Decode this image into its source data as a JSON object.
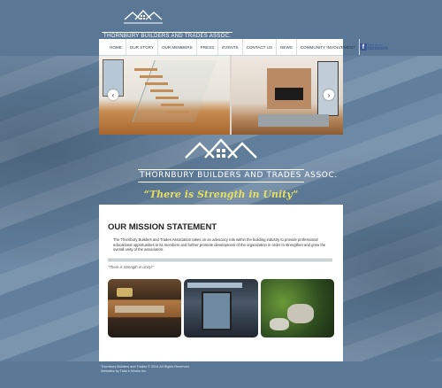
{
  "site": {
    "brand": "THORNBURY BUILDERS AND TRADES ASSOC.",
    "brand_small": "THORNBURY BUILDERS AND TRADES ASSOC.",
    "tagline": "“There is Strength in Unity”"
  },
  "nav": {
    "items": [
      {
        "label": "HOME"
      },
      {
        "label": "OUR STORY"
      },
      {
        "label": "OUR MEMBERS"
      },
      {
        "label": "PRESS"
      },
      {
        "label": "EVENTS"
      },
      {
        "label": "CONTACT US"
      },
      {
        "label": "NEWS"
      },
      {
        "label": "COMMUNITY INVOLVEMENT"
      }
    ],
    "facebook": {
      "small": "Find us on",
      "big": "facebook"
    }
  },
  "slider": {
    "prev_icon": "chevron-left-icon",
    "next_icon": "chevron-right-icon"
  },
  "mission": {
    "title": "OUR MISSION STATEMENT",
    "body": "The Thornbury Builders and Trades Association takes on an advocacy role within the building industry to provide professional educational opportunities to its members and further promote development of the organization in order to strengthen and grow the overall unity of the association.",
    "quote": "\"There is Strength in Unity!\""
  },
  "footer": {
    "copyright": "Thornbury Builders and Trades © 2014 All Rights Reserved.",
    "credit": "Websites by Tidal e-Works Inc."
  },
  "colors": {
    "background": "#5a7896",
    "tagline": "#e7df5c",
    "content_bg": "#ffffff",
    "facebook": "#3b5998"
  }
}
